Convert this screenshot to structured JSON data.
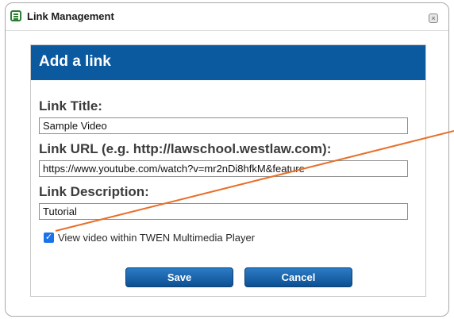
{
  "window": {
    "title": "Link Management",
    "close_icon": "close-icon",
    "close_glyph": "×"
  },
  "panel": {
    "heading": "Add a link",
    "heading_bg": "#0b5aa0"
  },
  "form": {
    "title_label": "Link Title:",
    "title_value": "Sample Video",
    "url_label": "Link URL (e.g. http://lawschool.westlaw.com):",
    "url_value": "https://www.youtube.com/watch?v=mr2nDi8hfkM&feature",
    "description_label": "Link Description:",
    "description_value": "Tutorial",
    "multimedia_checkbox_label": "View video within TWEN Multimedia Player",
    "multimedia_checked": true,
    "check_glyph": "✓"
  },
  "buttons": {
    "save_label": "Save",
    "cancel_label": "Cancel"
  },
  "annotation": {
    "color": "#e8702a"
  }
}
